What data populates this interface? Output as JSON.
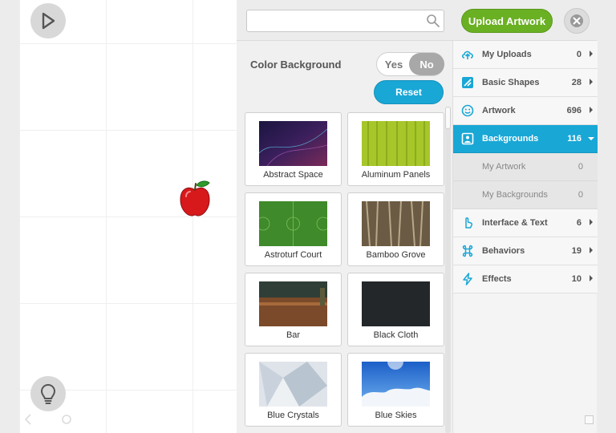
{
  "toolbar": {
    "search_value": "",
    "search_placeholder": "",
    "upload_label": "Upload Artwork"
  },
  "controls": {
    "color_background_label": "Color Background",
    "toggle_yes": "Yes",
    "toggle_no": "No",
    "toggle_selected": "No",
    "reset_label": "Reset"
  },
  "tiles": [
    {
      "label": "Abstract Space"
    },
    {
      "label": "Aluminum Panels"
    },
    {
      "label": "Astroturf Court"
    },
    {
      "label": "Bamboo Grove"
    },
    {
      "label": "Bar"
    },
    {
      "label": "Black Cloth"
    },
    {
      "label": "Blue Crystals"
    },
    {
      "label": "Blue Skies"
    }
  ],
  "categories": [
    {
      "label": "My Uploads",
      "count": "0",
      "icon": "upload-cloud-icon"
    },
    {
      "label": "Basic Shapes",
      "count": "28",
      "icon": "shapes-icon"
    },
    {
      "label": "Artwork",
      "count": "696",
      "icon": "smiley-icon"
    },
    {
      "label": "Backgrounds",
      "count": "116",
      "icon": "image-icon",
      "active": true
    },
    {
      "label": "My Artwork",
      "count": "0",
      "sub": true
    },
    {
      "label": "My Backgrounds",
      "count": "0",
      "sub": true
    },
    {
      "label": "Interface & Text",
      "count": "6",
      "icon": "pointer-icon"
    },
    {
      "label": "Behaviors",
      "count": "19",
      "icon": "command-icon"
    },
    {
      "label": "Effects",
      "count": "10",
      "icon": "bolt-icon"
    }
  ],
  "colors": {
    "accent_blue": "#19a7d6",
    "upload_green": "#6ab023",
    "toggle_gray": "#a8a8a8"
  }
}
